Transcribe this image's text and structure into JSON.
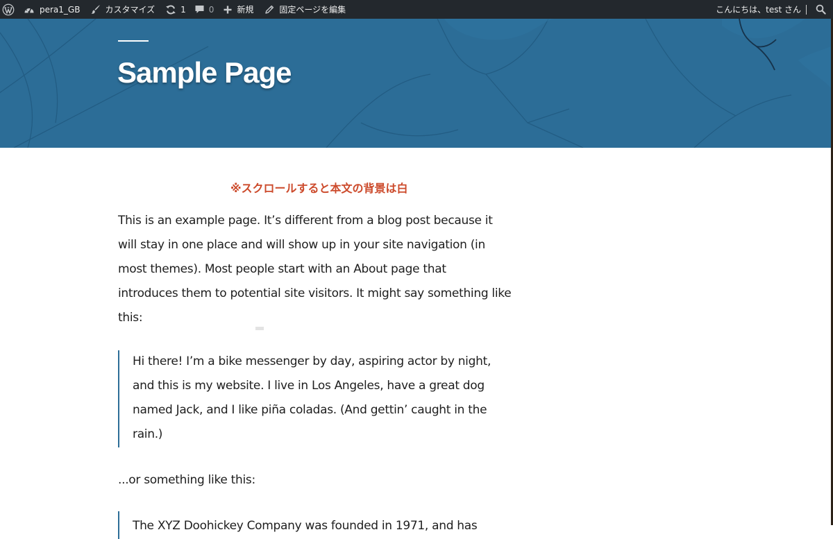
{
  "admin_bar": {
    "site_name": "pera1_GB",
    "customize_label": "カスタマイズ",
    "updates_count": "1",
    "comments_count": "0",
    "new_label": "新規",
    "edit_page_label": "固定ページを編集",
    "greeting": "こんにちは、test さん"
  },
  "page": {
    "title": "Sample Page",
    "notice": "※スクロールすると本文の背景は白",
    "intro_lines": [
      "This is an example page. It’s different from a blog post because it",
      "will stay in one place and will show up in your site navigation (in",
      "most themes). Most people start with an About page that",
      "introduces them to potential site visitors. It might say something like",
      "this:"
    ],
    "quote1_lines": [
      "Hi there! I’m a bike messenger by day, aspiring actor by night,",
      "and this is my website. I live in Los Angeles, have a great dog",
      "named Jack, and I like piña coladas. (And gettin’ caught in the",
      "rain.)"
    ],
    "transition": "...or something like this:",
    "quote2_lines": [
      "The XYZ Doohickey Company was founded in 1971, and has"
    ]
  },
  "colors": {
    "admin_bar_bg": "#23282d",
    "header_bg": "#2c6d97",
    "notice_text": "#cc4a2b",
    "quote_border": "#2c6d97",
    "body_text": "#1e1e1e"
  },
  "icons": {
    "wordpress": "wordpress-logo-icon",
    "dashboard": "dashboard-gauge-icon",
    "customize": "brush-icon",
    "updates": "refresh-icon",
    "comments": "comment-bubble-icon",
    "new": "plus-icon",
    "edit": "pencil-icon",
    "search": "search-icon"
  }
}
